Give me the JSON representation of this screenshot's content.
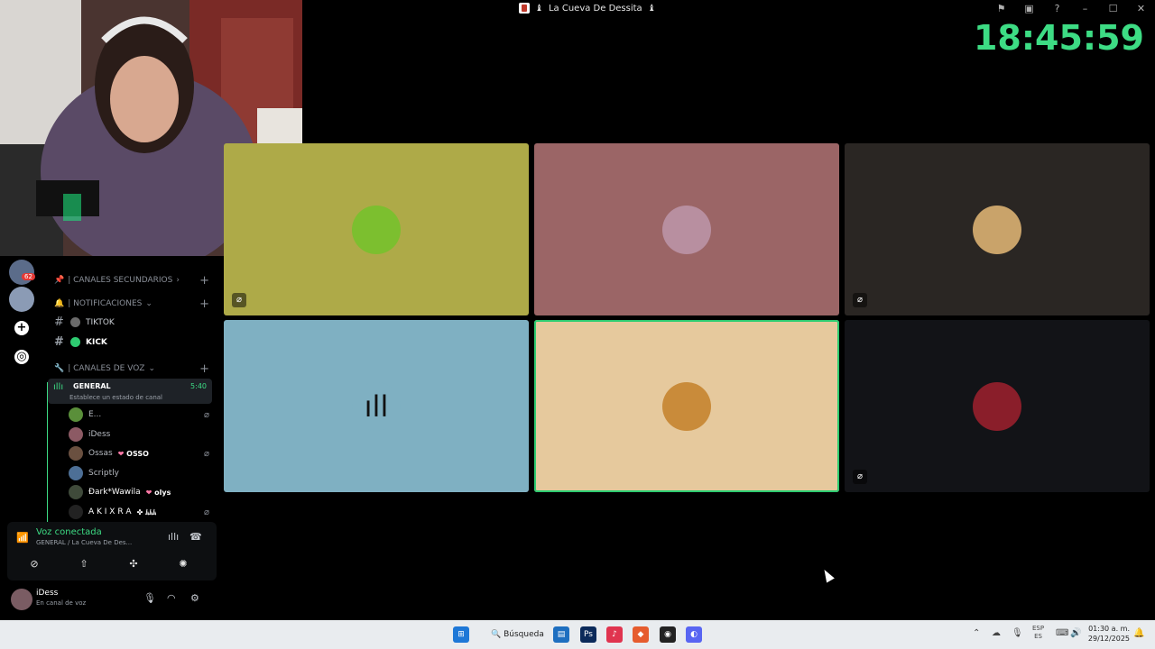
{
  "window": {
    "title": "La Cueva De Dessita",
    "title_decor_left": "♝",
    "title_decor_right": "♝",
    "controls": [
      "flag-icon",
      "screen-icon",
      "help-icon",
      "minimize-icon",
      "maximize-icon",
      "close-icon"
    ]
  },
  "overlay": {
    "clock": "18:45:59"
  },
  "rail": {
    "badge": "62"
  },
  "sidebar": {
    "categories": [
      {
        "label": "| CANALES SECUNDARIOS",
        "icon": "pin-icon"
      },
      {
        "label": "| NOTIFICACIONES",
        "icon": "bell-icon"
      },
      {
        "label": "| CANALES DE VOZ",
        "icon": "wrench-icon"
      }
    ],
    "text_channels": [
      {
        "label": "TIKTOK",
        "dot_color": "#6b6b6b",
        "bold": false
      },
      {
        "label": "KICK",
        "dot_color": "#2ecc71",
        "bold": true
      }
    ],
    "voice_channel": {
      "name": "GENERAL",
      "status": "Establece un estado de canal",
      "elapsed": "5:40"
    },
    "members": [
      {
        "name": "E...",
        "tag": "",
        "muted": true,
        "avatar_color": "#5a8f3a"
      },
      {
        "name": "iDess",
        "tag": "",
        "muted": false,
        "avatar_color": "#8c5a64"
      },
      {
        "name": "Ossas",
        "tag": "OSSO",
        "muted": true,
        "avatar_color": "#6a5040"
      },
      {
        "name": "Scriptly",
        "tag": "",
        "muted": false,
        "avatar_color": "#4d6f96"
      },
      {
        "name": "Ðark*Wawila",
        "tag": "olys",
        "muted": false,
        "avatar_color": "#3f4a3a"
      },
      {
        "name": "A K I X R A",
        "tag": "✤ ﾑﾑﾑ",
        "muted": true,
        "avatar_color": "#222"
      }
    ]
  },
  "voice_panel": {
    "title": "Voz conectada",
    "subtitle": "GENERAL / La Cueva De Des...",
    "buttons": [
      "camera-off-icon",
      "screen-share-icon",
      "activities-icon",
      "soundboard-icon"
    ]
  },
  "user_panel": {
    "username": "iDess",
    "status": "En canal de voz"
  },
  "tiles": [
    {
      "bg": "#aeaa48",
      "avatar_color": "#7cbf2f",
      "muted": true,
      "speaking": false
    },
    {
      "bg": "#9b6566",
      "avatar_color": "#b88fa0",
      "muted": false,
      "speaking": false
    },
    {
      "bg": "#2a2623",
      "avatar_color": "#c9a36a",
      "muted": true,
      "speaking": false
    },
    {
      "bg": "#7fb0c2",
      "avatar_color": "#7fb0c2",
      "muted": false,
      "speaking": false
    },
    {
      "bg": "#e6c99d",
      "avatar_color": "#c98b3a",
      "muted": false,
      "speaking": true
    },
    {
      "bg": "#121317",
      "avatar_color": "#8a1e2a",
      "muted": true,
      "speaking": false
    }
  ],
  "taskbar": {
    "search_label": "Búsqueda",
    "lang_top": "ESP",
    "lang_bottom": "ES",
    "time": "01:30 a. m.",
    "date": "29/12/2025"
  }
}
